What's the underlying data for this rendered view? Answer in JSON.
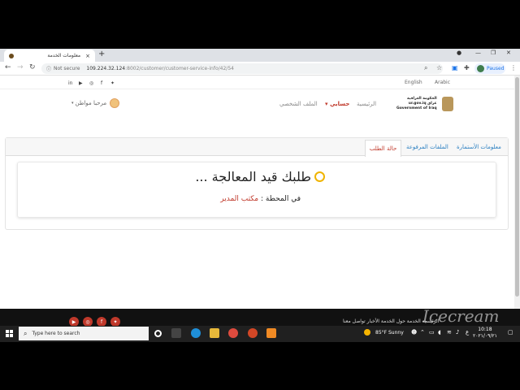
{
  "browser": {
    "tab_title": "معلومات الخدمة",
    "new_tab": "+",
    "url_security": "Not secure",
    "url_host": "109.224.32.124",
    "url_path": ":8002/customer/customer-service-info/42/54",
    "profile_status": "Paused"
  },
  "header": {
    "lang_english": "English",
    "lang_arabic": "Arabic",
    "social": [
      "in",
      "▶",
      "◎",
      "f",
      "✦"
    ],
    "logo_line1": "الحكومة العراقية",
    "logo_line2": "ur.gov.iq عراق",
    "logo_line3": "Government of Iraq",
    "menu_home": "الرئيسية",
    "menu_account": "حسابي",
    "menu_profile": "الملف الشخصي",
    "user_greeting": "مرحبا مواطن"
  },
  "tabs": {
    "application_info": "معلومات الأستمارة",
    "uploaded_files": "الملفات المرفوعة",
    "request_status": "حالة الطلب"
  },
  "status": {
    "title": "طلبك قيد المعالجة ...",
    "station_label": "في المحطة : ",
    "station_value": "مكتب المدير"
  },
  "footer": {
    "links": "الرئيسية  الخدمة  حول الخدمة  الأخبار  تواصل معنا"
  },
  "taskbar": {
    "search_placeholder": "Type here to search",
    "weather": "85°F  Sunny",
    "time": "10:18",
    "date": "٢٠٢١/٠٩/٢١",
    "lang": "ع"
  },
  "watermark": "Icecream",
  "colors": {
    "accent_red": "#c0392b",
    "link_blue": "#2a7fc1",
    "clock_icon": "#f0b400"
  }
}
